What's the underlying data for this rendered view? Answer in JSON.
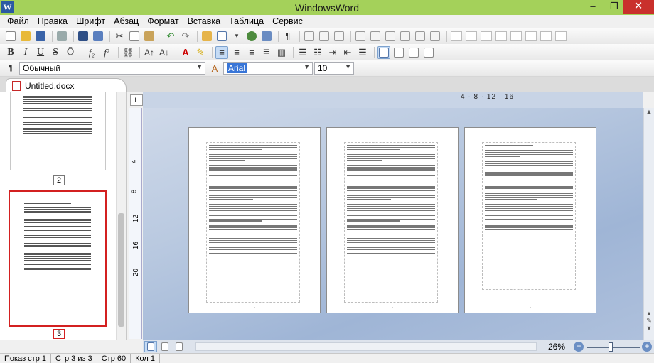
{
  "app": {
    "title": "WindowsWord",
    "icon_letter": "W",
    "window_controls": [
      "minimize",
      "maximize",
      "close"
    ]
  },
  "menu": [
    "Файл",
    "Правка",
    "Шрифт",
    "Абзац",
    "Формат",
    "Вставка",
    "Таблица",
    "Сервис"
  ],
  "format": {
    "style_value": "Обычный",
    "font_value": "Arial",
    "size_value": "10"
  },
  "tab": {
    "label": "Untitled.docx"
  },
  "thumbnails": {
    "page2_label": "2",
    "page3_label": "3",
    "selected": "3"
  },
  "ruler": {
    "horizontal": "4 · 8 · 12 · 16",
    "vertical_ticks": [
      "4",
      "8",
      "12",
      "16",
      "20"
    ]
  },
  "pages": {
    "count": 3
  },
  "zoom": {
    "value": "26%",
    "minus": "−",
    "plus": "+"
  },
  "status": {
    "page_view": "Показ стр 1",
    "page_of": "Стр 3 из 3",
    "line": "Стр 60",
    "column": "Кол 1"
  },
  "colors": {
    "titlebar": "#a4d15a",
    "selection_border": "#d32020",
    "canvas": "#b9c9e0"
  }
}
